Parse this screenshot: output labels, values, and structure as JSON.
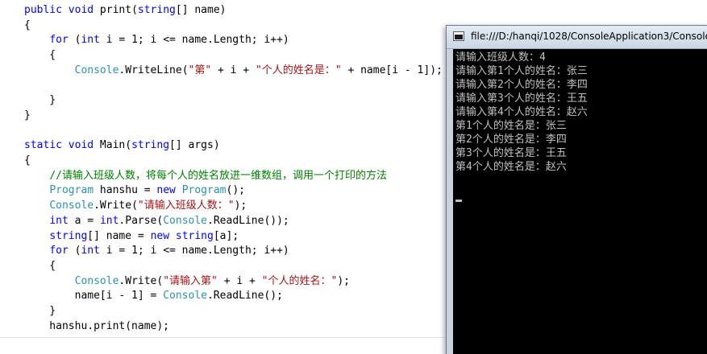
{
  "console": {
    "title": "file:///D:/hanqi/1028/ConsoleApplication3/Console",
    "lines": [
      "请输入班级人数：4",
      "请输入第1个人的姓名：张三",
      "请输入第2个人的姓名：李四",
      "请输入第3个人的姓名：王五",
      "请输入第4个人的姓名：赵六",
      "第1个人的姓名是：张三",
      "第2个人的姓名是：李四",
      "第3个人的姓名是：王五",
      "第4个人的姓名是：赵六"
    ]
  },
  "colors": {
    "keyword": "#0000ff",
    "string": "#a31515",
    "type": "#2b91af",
    "comment": "#008000",
    "plain": "#000000",
    "console_bg": "#000000",
    "console_fg": "#c0c0c0"
  },
  "icons": {
    "console_app": "console-app-icon"
  },
  "code": [
    [
      [
        "kw",
        "public"
      ],
      [
        "pl",
        " "
      ],
      [
        "kw",
        "void"
      ],
      [
        "pl",
        " print("
      ],
      [
        "kw",
        "string"
      ],
      [
        "pl",
        "[] name)"
      ]
    ],
    [
      [
        "pl",
        "{"
      ]
    ],
    [
      [
        "pl",
        "    "
      ],
      [
        "kw",
        "for"
      ],
      [
        "pl",
        " ("
      ],
      [
        "kw",
        "int"
      ],
      [
        "pl",
        " i = 1; i <= name.Length; i++)"
      ]
    ],
    [
      [
        "pl",
        "    {"
      ]
    ],
    [
      [
        "pl",
        "        "
      ],
      [
        "type",
        "Console"
      ],
      [
        "pl",
        ".WriteLine("
      ],
      [
        "str",
        "\"第\""
      ],
      [
        "pl",
        " + i + "
      ],
      [
        "str",
        "\"个人的姓名是：\""
      ],
      [
        "pl",
        " + name[i - 1]);"
      ]
    ],
    [],
    [
      [
        "pl",
        "    }"
      ]
    ],
    [
      [
        "pl",
        "}"
      ]
    ],
    [],
    [
      [
        "kw",
        "static"
      ],
      [
        "pl",
        " "
      ],
      [
        "kw",
        "void"
      ],
      [
        "pl",
        " Main("
      ],
      [
        "kw",
        "string"
      ],
      [
        "pl",
        "[] args)"
      ]
    ],
    [
      [
        "pl",
        "{"
      ]
    ],
    [
      [
        "pl",
        "    "
      ],
      [
        "cmt",
        "//请输入班级人数，将每个人的姓名放进一维数组，调用一个打印的方法"
      ]
    ],
    [
      [
        "pl",
        "    "
      ],
      [
        "type",
        "Program"
      ],
      [
        "pl",
        " hanshu = "
      ],
      [
        "kw",
        "new"
      ],
      [
        "pl",
        " "
      ],
      [
        "type",
        "Program"
      ],
      [
        "pl",
        "();"
      ]
    ],
    [
      [
        "pl",
        "    "
      ],
      [
        "type",
        "Console"
      ],
      [
        "pl",
        ".Write("
      ],
      [
        "str",
        "\"请输入班级人数：\""
      ],
      [
        "pl",
        ");"
      ]
    ],
    [
      [
        "pl",
        "    "
      ],
      [
        "kw",
        "int"
      ],
      [
        "pl",
        " a = "
      ],
      [
        "kw",
        "int"
      ],
      [
        "pl",
        ".Parse("
      ],
      [
        "type",
        "Console"
      ],
      [
        "pl",
        ".ReadLine());"
      ]
    ],
    [
      [
        "pl",
        "    "
      ],
      [
        "kw",
        "string"
      ],
      [
        "pl",
        "[] name = "
      ],
      [
        "kw",
        "new"
      ],
      [
        "pl",
        " "
      ],
      [
        "kw",
        "string"
      ],
      [
        "pl",
        "[a];"
      ]
    ],
    [
      [
        "pl",
        "    "
      ],
      [
        "kw",
        "for"
      ],
      [
        "pl",
        " ("
      ],
      [
        "kw",
        "int"
      ],
      [
        "pl",
        " i = 1; i <= name.Length; i++)"
      ]
    ],
    [
      [
        "pl",
        "    {"
      ]
    ],
    [
      [
        "pl",
        "        "
      ],
      [
        "type",
        "Console"
      ],
      [
        "pl",
        ".Write("
      ],
      [
        "str",
        "\"请输入第\""
      ],
      [
        "pl",
        " + i + "
      ],
      [
        "str",
        "\"个人的姓名：\""
      ],
      [
        "pl",
        ");"
      ]
    ],
    [
      [
        "pl",
        "        name[i - 1] = "
      ],
      [
        "type",
        "Console"
      ],
      [
        "pl",
        ".ReadLine();"
      ]
    ],
    [
      [
        "pl",
        "    }"
      ]
    ],
    [
      [
        "pl",
        "    hanshu.print(name);"
      ]
    ]
  ]
}
